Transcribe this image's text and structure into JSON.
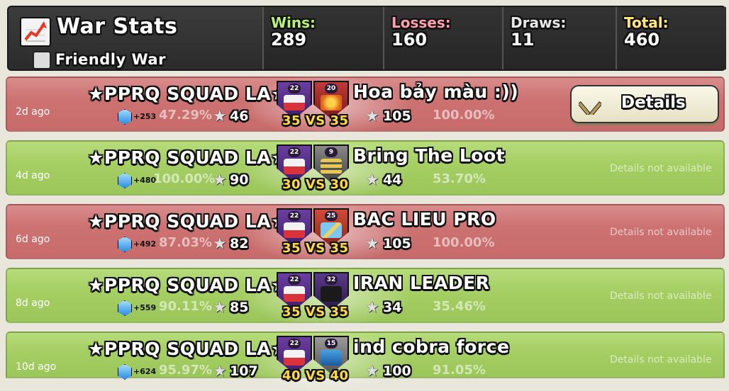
{
  "header": {
    "title": "War Stats",
    "friendly_war_label": "Friendly War",
    "friendly_war_checked": false,
    "stats": {
      "wins_label": "Wins:",
      "wins": "289",
      "losses_label": "Losses:",
      "losses": "160",
      "draws_label": "Draws:",
      "draws": "11",
      "total_label": "Total:",
      "total": "460"
    }
  },
  "colors": {
    "loss_row": "#cd7272",
    "win_row": "#a6cf64",
    "vs_text": "#ffd84a"
  },
  "wars": [
    {
      "result": "loss",
      "ago": "2d ago",
      "clan_name": "★PPRQ SQUAD LA★",
      "clan_level": "22",
      "xp": "+253",
      "clan_destruction": "47.29%",
      "clan_stars": "46",
      "vs_text": "35 VS 35",
      "opponent_name": "Hoa bảy màu :))",
      "opponent_level": "20",
      "opponent_stars": "105",
      "opponent_destruction": "100.00%",
      "action": "Details",
      "action_icon": "crossed-swords-icon"
    },
    {
      "result": "win",
      "ago": "4d ago",
      "clan_name": "★PPRQ SQUAD LA★",
      "clan_level": "22",
      "xp": "+480",
      "clan_destruction": "100.00%",
      "clan_stars": "90",
      "vs_text": "30 VS 30",
      "opponent_name": "Bring The Loot",
      "opponent_level": "9",
      "opponent_stars": "44",
      "opponent_destruction": "53.70%",
      "action": "Details not available"
    },
    {
      "result": "loss",
      "ago": "6d ago",
      "clan_name": "★PPRQ SQUAD LA★",
      "clan_level": "22",
      "xp": "+492",
      "clan_destruction": "87.03%",
      "clan_stars": "82",
      "vs_text": "35 VS 35",
      "opponent_name": "BAC LIEU PRO",
      "opponent_level": "25",
      "opponent_stars": "105",
      "opponent_destruction": "100.00%",
      "action": "Details not available"
    },
    {
      "result": "win",
      "ago": "8d ago",
      "clan_name": "★PPRQ SQUAD LA★",
      "clan_level": "22",
      "xp": "+559",
      "clan_destruction": "90.11%",
      "clan_stars": "85",
      "vs_text": "35 VS 35",
      "opponent_name": "IRAN LEADER",
      "opponent_level": "32",
      "opponent_stars": "34",
      "opponent_destruction": "35.46%",
      "action": "Details not available"
    },
    {
      "result": "win",
      "ago": "10d ago",
      "clan_name": "★PPRQ SQUAD LA★",
      "clan_level": "22",
      "xp": "+624",
      "clan_destruction": "95.97%",
      "clan_stars": "107",
      "vs_text": "40 VS 40",
      "opponent_name": "ind cobra force",
      "opponent_level": "15",
      "opponent_stars": "100",
      "opponent_destruction": "91.05%",
      "action": "Details not available"
    }
  ]
}
